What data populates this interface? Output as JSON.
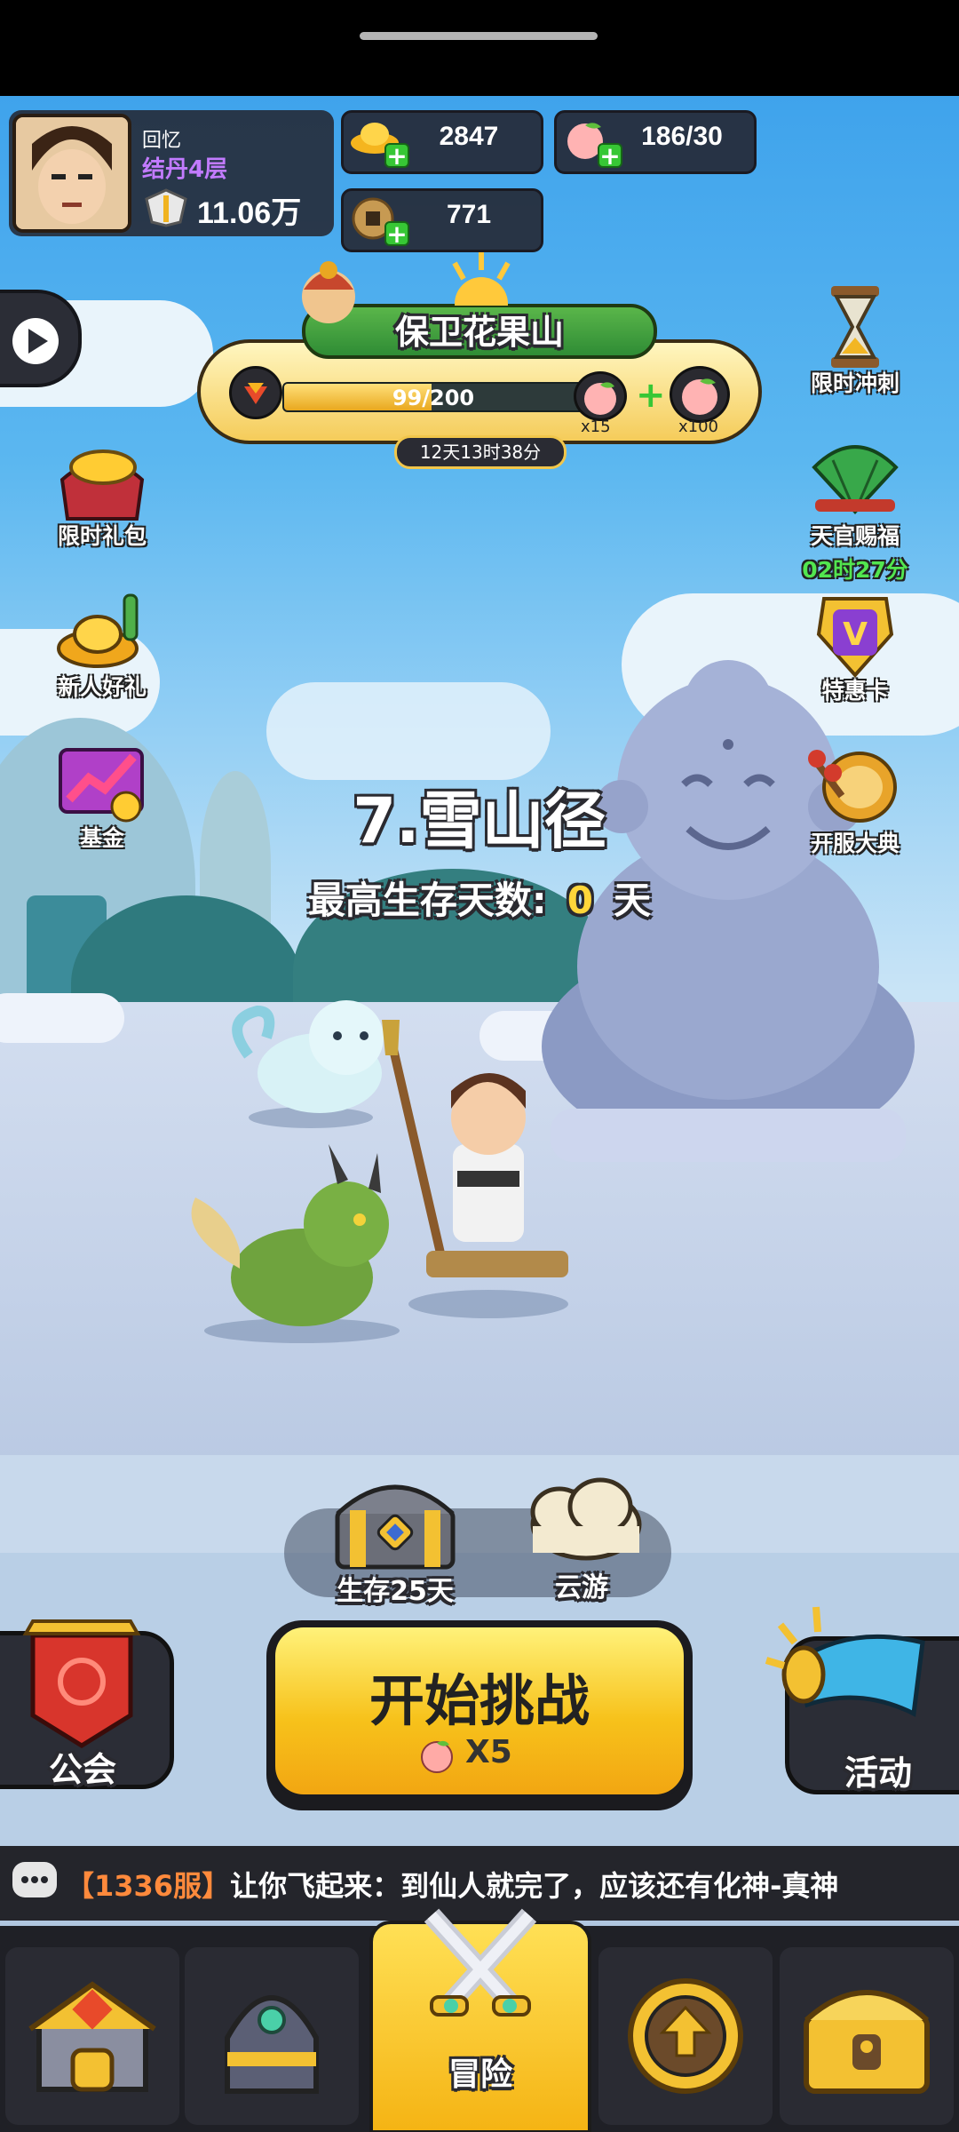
{
  "player": {
    "name": "回忆",
    "realm": "结丹4层",
    "power": "11.06万"
  },
  "resources": {
    "gold": "2847",
    "peach": "186/30",
    "coins": "771"
  },
  "event": {
    "title": "保卫花果山",
    "progress_text": "99/200",
    "progress": 0.495,
    "reward_small": "x15",
    "reward_big": "x100",
    "timer": "12天13时38分"
  },
  "left_menu": [
    {
      "label": "限时礼包",
      "icon": "gift-bag-icon"
    },
    {
      "label": "新人好礼",
      "icon": "gold-ingot-icon"
    },
    {
      "label": "基金",
      "icon": "fund-chart-icon"
    }
  ],
  "right_menu": [
    {
      "label": "限时冲刺",
      "icon": "hourglass-icon"
    },
    {
      "label": "天官赐福",
      "icon": "fan-icon",
      "timer": "02时27分"
    },
    {
      "label": "特惠卡",
      "icon": "vip-card-icon"
    },
    {
      "label": "开服大典",
      "icon": "drum-icon"
    }
  ],
  "stage": {
    "name": "7.雪山径",
    "record_label": "最高生存天数:",
    "record_value": "0",
    "record_unit": "天"
  },
  "mini_actions": {
    "chest_label": "生存25天",
    "travel_label": "云游"
  },
  "actions": {
    "guild": "公会",
    "start": "开始挑战",
    "cost": "X5",
    "activity": "活动"
  },
  "chat": {
    "server": "【1336服】",
    "message": "让你飞起来：到仙人就完了，应该还有化神-真神"
  },
  "nav": {
    "active_label": "冒险"
  },
  "colors": {
    "accent_yellow": "#f7c21b",
    "realm_purple": "#c27bff",
    "timer_green": "#52e64f",
    "server_orange": "#ff8a3c"
  }
}
